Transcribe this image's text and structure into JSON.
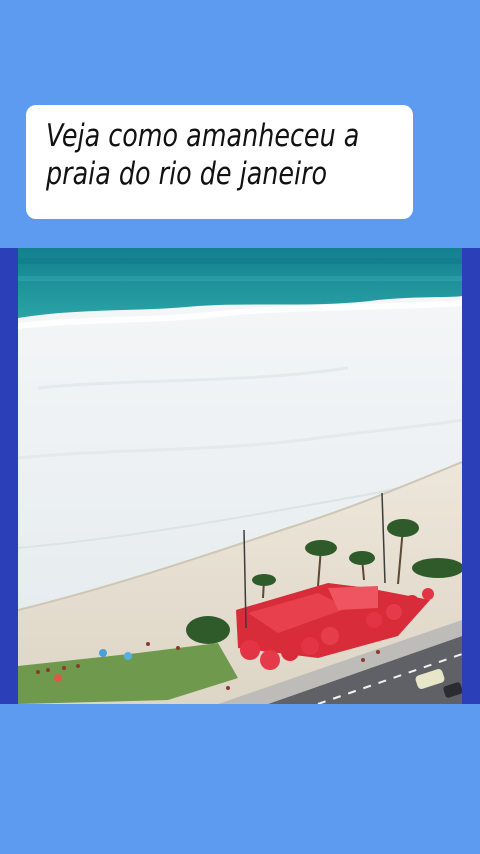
{
  "caption": {
    "line1": "Veja como amanheceu a",
    "line2": "praia do rio de  janeiro"
  },
  "colors": {
    "background": "#5d9bf0",
    "frame_border": "#2b3fb8",
    "ocean": "#1d8f9a",
    "foam": "#eef2f4",
    "sand": "#e8e2d6",
    "kiosk_red": "#e0323f",
    "road": "#5f6166"
  },
  "photo": {
    "subject": "aerial view of beach with heavy surf, red umbrellas kiosk, palm trees and coastal road"
  }
}
